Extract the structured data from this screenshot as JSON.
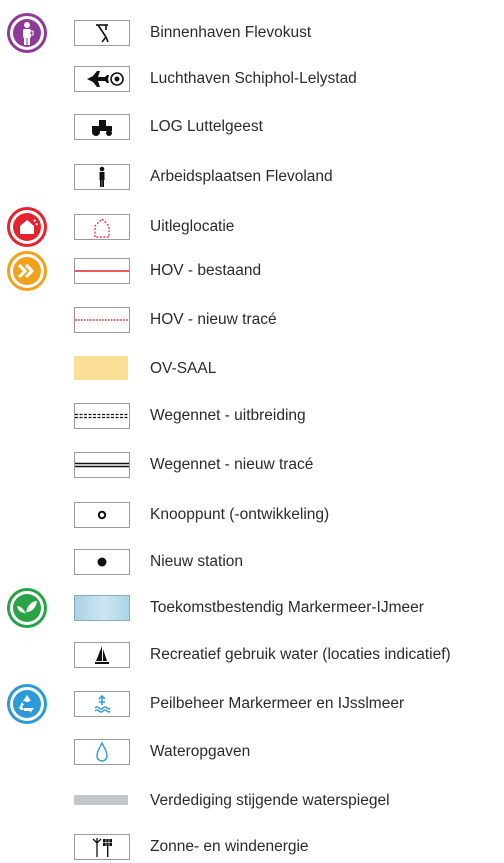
{
  "legend": {
    "items": [
      {
        "label": "Binnenhaven Flevokust",
        "icon": "harbor-crane-icon",
        "category_icon": "worker-icon",
        "category_color": "#8e3a96"
      },
      {
        "label": "Luchthaven Schiphol-Lelystad",
        "icon": "airplane-icon"
      },
      {
        "label": "LOG Luttelgeest",
        "icon": "tractor-icon"
      },
      {
        "label": "Arbeidsplaatsen Flevoland",
        "icon": "person-icon"
      },
      {
        "label": "Uitleglocatie",
        "icon": "dashed-house-icon",
        "category_icon": "house-icon",
        "category_color": "#e5232f"
      },
      {
        "label": "HOV - bestaand",
        "icon": "solid-red-line-icon",
        "category_icon": "double-chevron-icon",
        "category_color": "#f4a11a"
      },
      {
        "label": "HOV - nieuw tracé",
        "icon": "dotted-red-line-icon"
      },
      {
        "label": "OV-SAAL",
        "icon": "yellow-band-icon"
      },
      {
        "label": "Wegennet - uitbreiding",
        "icon": "dashed-road-icon"
      },
      {
        "label": "Wegennet - nieuw tracé",
        "icon": "double-line-road-icon"
      },
      {
        "label": "Knooppunt (-ontwikkeling)",
        "icon": "open-circle-icon"
      },
      {
        "label": "Nieuw station",
        "icon": "filled-circle-icon"
      },
      {
        "label": "Toekomstbestendig Markermeer-IJmeer",
        "icon": "water-area-icon",
        "category_icon": "leaf-icon",
        "category_color": "#2aa246"
      },
      {
        "label": "Recreatief gebruik water (locaties indicatief)",
        "icon": "sailboat-icon"
      },
      {
        "label": "Peilbeheer Markermeer en IJsslmeer",
        "icon": "water-level-icon",
        "category_icon": "recycle-icon",
        "category_color": "#2c9ad7"
      },
      {
        "label": "Wateropgaven",
        "icon": "water-drop-icon"
      },
      {
        "label": "Verdediging stijgende waterspiegel",
        "icon": "grey-band-icon"
      },
      {
        "label": "Zonne- en windenergie",
        "icon": "wind-solar-icon"
      }
    ]
  }
}
